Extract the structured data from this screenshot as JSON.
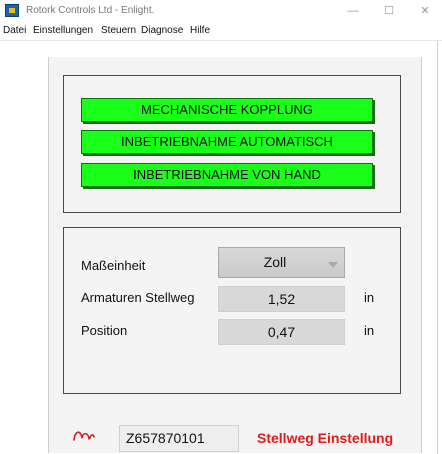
{
  "window": {
    "title": "Rotork Controls Ltd - Enlight.",
    "minimize_symbol": "—",
    "maximize_symbol": "☐",
    "close_symbol": "✕",
    "icon": "rotork-app-icon"
  },
  "menu": [
    "Datei",
    "Einstellungen",
    "Steuern",
    "Diagnose",
    "Hilfe"
  ],
  "actions": {
    "mechanical_coupling": "MECHANISCHE KOPPLUNG",
    "commissioning_auto": "INBETRIEBNAHME AUTOMATISCH",
    "commissioning_manual": "INBETRIEBNAHME VON HAND",
    "button_color": "#19ff19"
  },
  "settings": {
    "unit_label": "Maßeinheit",
    "unit_value": "Zoll",
    "stroke_label": "Armaturen Stellweg",
    "stroke_value": "1,52",
    "stroke_unit": "in",
    "position_label": "Position",
    "position_value": "0,47",
    "position_unit": "in"
  },
  "footer": {
    "icon": "signal-wave-icon",
    "device_id": "Z657870101",
    "status": "Stellweg Einstellung",
    "status_color": "#e01b1b"
  }
}
